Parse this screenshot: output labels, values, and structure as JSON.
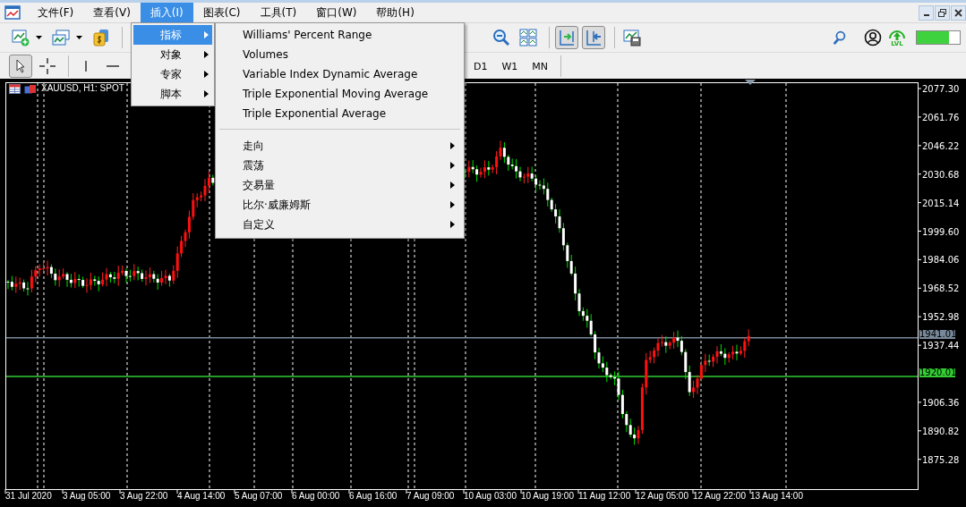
{
  "menu_bar": [
    {
      "label": "文件(F)",
      "selected": false
    },
    {
      "label": "查看(V)",
      "selected": false
    },
    {
      "label": "插入(I)",
      "selected": true
    },
    {
      "label": "图表(C)",
      "selected": false
    },
    {
      "label": "工具(T)",
      "selected": false
    },
    {
      "label": "窗口(W)",
      "selected": false
    },
    {
      "label": "帮助(H)",
      "selected": false
    }
  ],
  "toolbar": {
    "chart_shift": {
      "pressed": true
    },
    "auto_scroll": {
      "pressed": true
    },
    "cursor_tool": {
      "pressed": true
    }
  },
  "timeframes": [
    "D1",
    "W1",
    "MN"
  ],
  "level_badge": "LVL",
  "insert_menu": [
    {
      "label": "指标",
      "selected": true
    },
    {
      "label": "对象",
      "selected": false
    },
    {
      "label": "专家",
      "selected": false
    },
    {
      "label": "脚本",
      "selected": false
    }
  ],
  "indicators_submenu": {
    "indicators": [
      "Williams' Percent Range",
      "Volumes",
      "Variable Index Dynamic Average",
      "Triple Exponential Moving Average",
      "Triple Exponential Average"
    ],
    "categories": [
      "走向",
      "震荡",
      "交易量",
      "比尔·威廉姆斯",
      "自定义"
    ]
  },
  "chart": {
    "title": "XAUUSD, H1: SPOT",
    "price_labels": [
      "2077.30",
      "2061.76",
      "2046.22",
      "2030.68",
      "2015.14",
      "1999.60",
      "1984.06",
      "1968.52",
      "1952.98",
      "1937.44",
      "1906.36",
      "1890.82",
      "1875.28"
    ],
    "levels": [
      {
        "label": "1941.01",
        "color": "#778899"
      },
      {
        "label": "1920.01",
        "color": "#32cd32"
      }
    ],
    "time_labels": [
      "31 Jul 2020",
      "3 Aug 05:00",
      "3 Aug 22:00",
      "4 Aug 14:00",
      "5 Aug 07:00",
      "6 Aug 00:00",
      "6 Aug 16:00",
      "7 Aug 09:00",
      "10 Aug 03:00",
      "10 Aug 19:00",
      "11 Aug 12:00",
      "12 Aug 05:00",
      "12 Aug 22:00",
      "13 Aug 14:00"
    ]
  }
}
